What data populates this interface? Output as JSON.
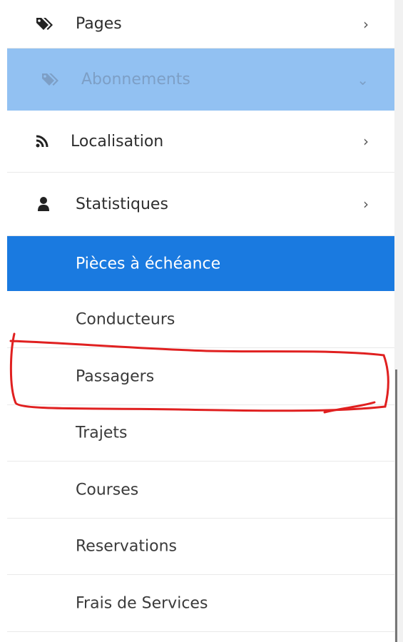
{
  "menu": {
    "pages": {
      "label": "Pages",
      "icon": "tags-icon",
      "chevron": "›"
    },
    "abonnements": {
      "label": "Abonnements",
      "icon": "tags-icon",
      "chevron": "⌄"
    },
    "localisation": {
      "label": "Localisation",
      "icon": "rss-icon",
      "chevron": "›"
    },
    "statistiques": {
      "label": "Statistiques",
      "icon": "user-icon",
      "chevron": "›",
      "children": [
        {
          "label": "Pièces à échéance",
          "active": true
        },
        {
          "label": "Conducteurs"
        },
        {
          "label": "Passagers",
          "highlighted": true
        },
        {
          "label": "Trajets"
        },
        {
          "label": "Courses"
        },
        {
          "label": "Reservations"
        },
        {
          "label": "Frais de Services"
        }
      ]
    }
  },
  "colors": {
    "active_bg": "#1a7ae0",
    "expanded_bg": "#92c1f2",
    "annotation_stroke": "#e02020"
  }
}
